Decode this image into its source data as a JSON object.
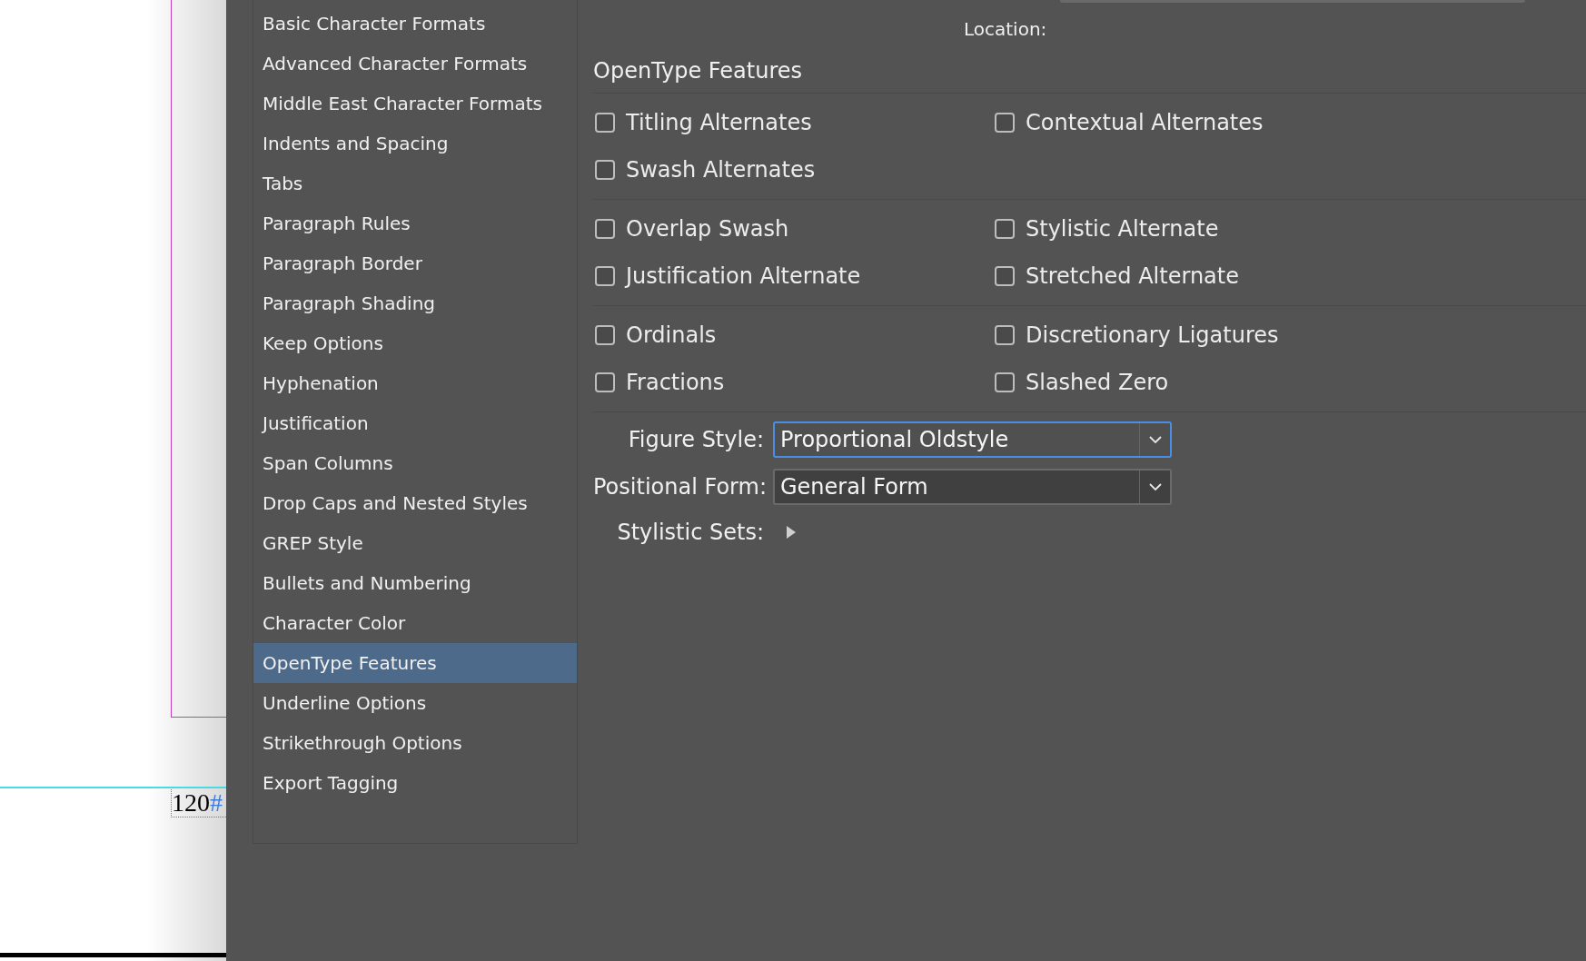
{
  "page": {
    "folio": "120",
    "folio_mark": "#"
  },
  "sidebar": {
    "items": [
      {
        "label": "Basic Character Formats",
        "selected": false
      },
      {
        "label": "Advanced Character Formats",
        "selected": false
      },
      {
        "label": "Middle East Character Formats",
        "selected": false
      },
      {
        "label": "Indents and Spacing",
        "selected": false
      },
      {
        "label": "Tabs",
        "selected": false
      },
      {
        "label": "Paragraph Rules",
        "selected": false
      },
      {
        "label": "Paragraph Border",
        "selected": false
      },
      {
        "label": "Paragraph Shading",
        "selected": false
      },
      {
        "label": "Keep Options",
        "selected": false
      },
      {
        "label": "Hyphenation",
        "selected": false
      },
      {
        "label": "Justification",
        "selected": false
      },
      {
        "label": "Span Columns",
        "selected": false
      },
      {
        "label": "Drop Caps and Nested Styles",
        "selected": false
      },
      {
        "label": "GREP Style",
        "selected": false
      },
      {
        "label": "Bullets and Numbering",
        "selected": false
      },
      {
        "label": "Character Color",
        "selected": false
      },
      {
        "label": "OpenType Features",
        "selected": true
      },
      {
        "label": "Underline Options",
        "selected": false
      },
      {
        "label": "Strikethrough Options",
        "selected": false
      },
      {
        "label": "Export Tagging",
        "selected": false
      }
    ]
  },
  "location": {
    "label": "Location:"
  },
  "section": {
    "title": "OpenType Features"
  },
  "checkbox_groups": [
    [
      {
        "label": "Titling Alternates",
        "checked": false
      },
      {
        "label": "Contextual Alternates",
        "checked": false
      },
      {
        "label": "Swash Alternates",
        "checked": false
      }
    ],
    [
      {
        "label": "Overlap Swash",
        "checked": false
      },
      {
        "label": "Stylistic Alternate",
        "checked": false
      },
      {
        "label": "Justification Alternate",
        "checked": false
      },
      {
        "label": "Stretched Alternate",
        "checked": false
      }
    ],
    [
      {
        "label": "Ordinals",
        "checked": false
      },
      {
        "label": "Discretionary Ligatures",
        "checked": false
      },
      {
        "label": "Fractions",
        "checked": false
      },
      {
        "label": "Slashed Zero",
        "checked": false
      }
    ]
  ],
  "dropdowns": [
    {
      "label": "Figure Style:",
      "value": "Proportional Oldstyle",
      "focused": true
    },
    {
      "label": "Positional Form:",
      "value": "General Form",
      "focused": false
    }
  ],
  "stylistic_sets": {
    "label": "Stylistic Sets:",
    "expanded": false
  }
}
